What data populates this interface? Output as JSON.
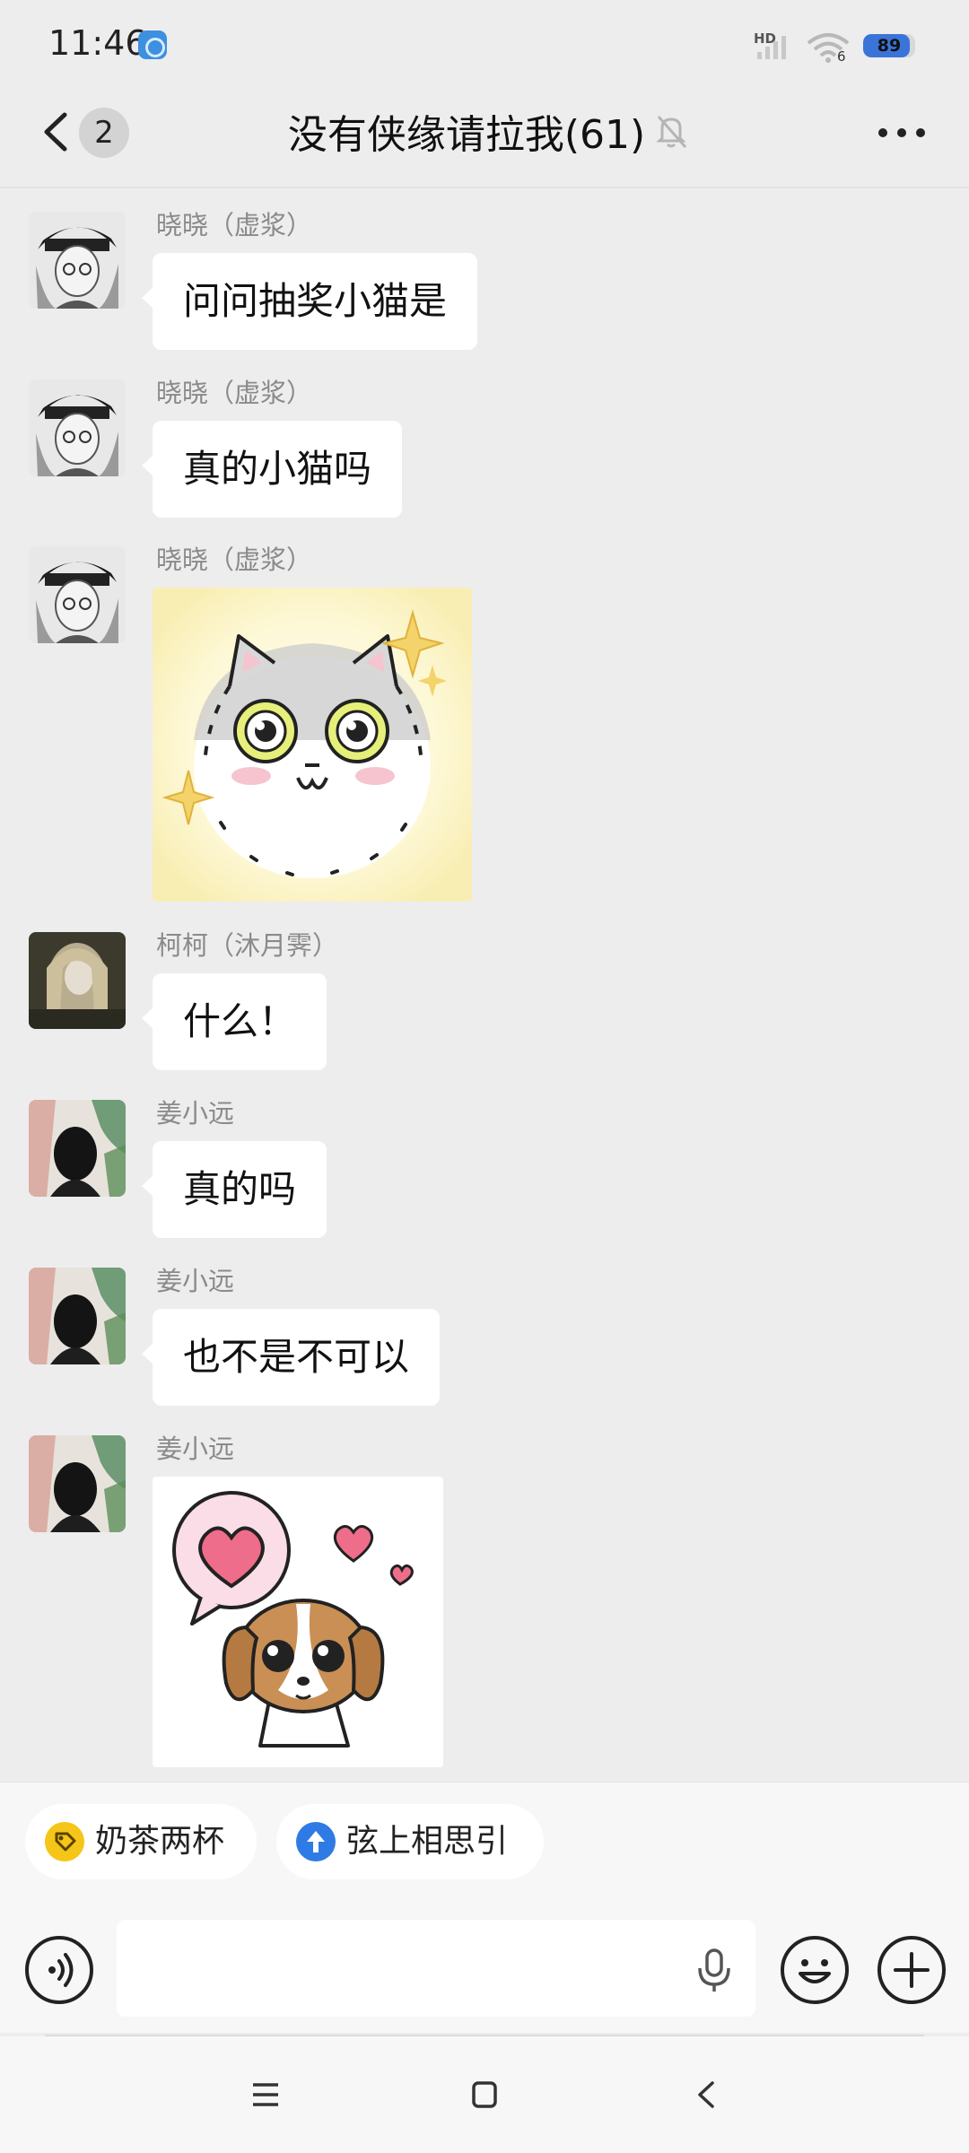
{
  "status_bar": {
    "time": "11:46",
    "network_label": "HD",
    "network_number": "6",
    "battery_level": "89"
  },
  "header": {
    "back_badge": "2",
    "title": "没有侠缘请拉我(61)"
  },
  "messages": [
    {
      "sender": "晓晓（虚浆）",
      "text": "问问抽奖小猫是"
    },
    {
      "sender": "晓晓（虚浆）",
      "text": "真的小猫吗"
    },
    {
      "sender": "晓晓（虚浆）",
      "sticker": "crying-cat-sticker"
    },
    {
      "sender": "柯柯（沐月霁）",
      "text": "什么！"
    },
    {
      "sender": "姜小远",
      "text": "真的吗"
    },
    {
      "sender": "姜小远",
      "text": "也不是不可以"
    },
    {
      "sender": "姜小远",
      "sticker": "heart-puppy-sticker"
    }
  ],
  "shortcuts": [
    {
      "label": "奶茶两杯",
      "icon": "tag-icon",
      "color": "#f5c518"
    },
    {
      "label": "弦上相思引",
      "icon": "arrow-up-icon",
      "color": "#2f7be6"
    }
  ],
  "input": {
    "placeholder": ""
  },
  "colors": {
    "background": "#ededed",
    "bubble": "#ffffff",
    "sender_name": "#8a8a8a"
  }
}
